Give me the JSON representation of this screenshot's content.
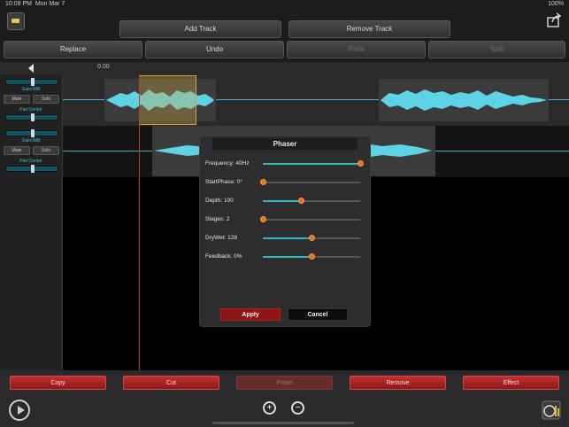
{
  "status": {
    "time": "10:09 PM",
    "date": "Mon Mar 7",
    "battery": "100%"
  },
  "toolbar": {
    "add_track": "Add Track",
    "remove_track": "Remove Track",
    "replace": "Replace",
    "undo": "Undo",
    "redo": "Redo",
    "split": "Split"
  },
  "ruler": {
    "start_time": "0.00"
  },
  "track_controls": [
    {
      "gain": "Gain:0dB",
      "mute": "Mute",
      "solo": "Solo",
      "pan": "Pan:Center"
    },
    {
      "gain": "Gain:0dB",
      "mute": "Mute",
      "solo": "Solo",
      "pan": "Pan:Center"
    }
  ],
  "phaser": {
    "title": "Phaser",
    "params": [
      {
        "label": "Frequency: 40Hz",
        "value": 1.0
      },
      {
        "label": "StartPhase: 0°",
        "value": 0.0
      },
      {
        "label": "Depth: 100",
        "value": 0.39
      },
      {
        "label": "Stages: 2",
        "value": 0.0
      },
      {
        "label": "DryWet: 128",
        "value": 0.5
      },
      {
        "label": "Feedback: 0%",
        "value": 0.5
      }
    ],
    "apply": "Apply",
    "cancel": "Cancel"
  },
  "actions": {
    "copy": "Copy",
    "cut": "Cut",
    "paste": "Paste",
    "remove": "Remove",
    "effect": "Effect"
  },
  "zoom": {
    "in": "+",
    "out": "−"
  },
  "colors": {
    "accent": "#3ab0c6",
    "knob": "#e0731e",
    "danger": "#c23030"
  }
}
